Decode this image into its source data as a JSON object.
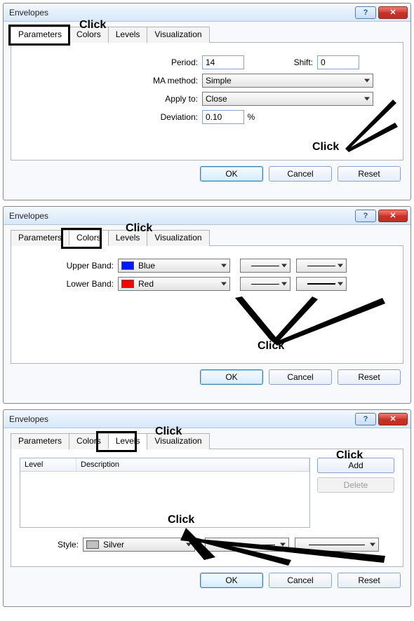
{
  "dialogs": {
    "title": "Envelopes",
    "tabs": {
      "parameters": "Parameters",
      "colors": "Colors",
      "levels": "Levels",
      "visualization": "Visualization"
    },
    "buttons": {
      "ok": "OK",
      "cancel": "Cancel",
      "reset": "Reset",
      "add": "Add",
      "delete": "Delete"
    }
  },
  "d1": {
    "period_label": "Period:",
    "period_value": "14",
    "shift_label": "Shift:",
    "shift_value": "0",
    "ma_label": "MA method:",
    "ma_value": "Simple",
    "apply_label": "Apply to:",
    "apply_value": "Close",
    "dev_label": "Deviation:",
    "dev_value": "0.10",
    "dev_unit": "%"
  },
  "d2": {
    "upper_label": "Upper Band:",
    "upper_value": "Blue",
    "upper_color": "#0018ff",
    "lower_label": "Lower Band:",
    "lower_value": "Red",
    "lower_color": "#ff0000"
  },
  "d3": {
    "col_level": "Level",
    "col_desc": "Description",
    "style_label": "Style:",
    "style_value": "Silver",
    "style_color": "#c0c0c0"
  },
  "anno": {
    "click": "Click"
  }
}
